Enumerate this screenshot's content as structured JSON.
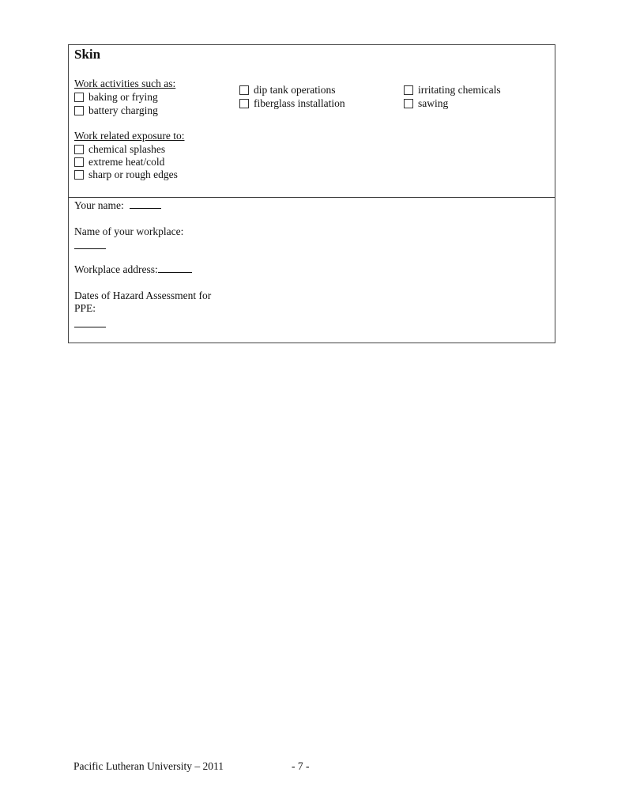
{
  "skin_section": {
    "title": "Skin",
    "work_activities": {
      "heading": "Work activities such as:",
      "items": [
        {
          "label": "baking or frying",
          "checked": false
        },
        {
          "label": "battery charging",
          "checked": false
        },
        {
          "label": "dip tank operations",
          "checked": false
        },
        {
          "label": "fiberglass installation",
          "checked": false
        },
        {
          "label": "irritating chemicals",
          "checked": false
        },
        {
          "label": "sawing",
          "checked": false
        }
      ]
    },
    "exposure": {
      "heading": "Work related exposure to:",
      "items": [
        {
          "label": "chemical splashes",
          "checked": false
        },
        {
          "label": "extreme heat/cold",
          "checked": false
        },
        {
          "label": "sharp or rough edges",
          "checked": false
        }
      ]
    }
  },
  "info_section": {
    "your_name_label": "Your name:",
    "your_name_value": "",
    "workplace_name_label": "Name of your workplace:",
    "workplace_name_value": "",
    "workplace_address_label": "Workplace address:",
    "workplace_address_value": "",
    "hazard_dates_label_line1": "Dates of Hazard Assessment for",
    "hazard_dates_label_line2": "PPE:",
    "hazard_dates_value": ""
  },
  "footer": {
    "organization": "Pacific Lutheran University – 2011",
    "page_number": "- 7 -"
  }
}
